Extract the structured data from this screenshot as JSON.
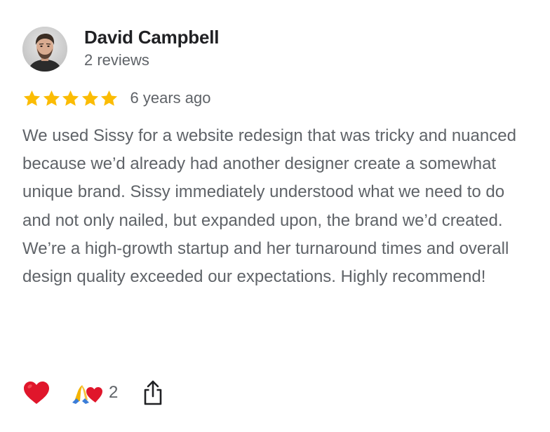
{
  "reviewer": {
    "name": "David Campbell",
    "review_count": "2 reviews"
  },
  "rating": {
    "value": 5,
    "max": 5,
    "time_ago": "6 years ago"
  },
  "review": {
    "text": "We used Sissy for a website redesign that was tricky and nuanced because we’d already had another designer create a somewhat unique brand. Sissy immediately understood what we need to do and not only nailed, but expanded upon, the brand we’d created. We’re a high-growth startup and her turnaround times and overall design quality exceeded our expectations. Highly recommend!"
  },
  "actions": {
    "reaction_count": "2",
    "heart_icon": "red-heart-icon",
    "reactions_icons": [
      "folded-hands-icon",
      "red-heart-icon"
    ],
    "share_icon": "share-icon"
  },
  "colors": {
    "star": "#fbbc04",
    "heart": "#e0162b",
    "secondary_text": "#5f6368",
    "primary_text": "#202124"
  }
}
